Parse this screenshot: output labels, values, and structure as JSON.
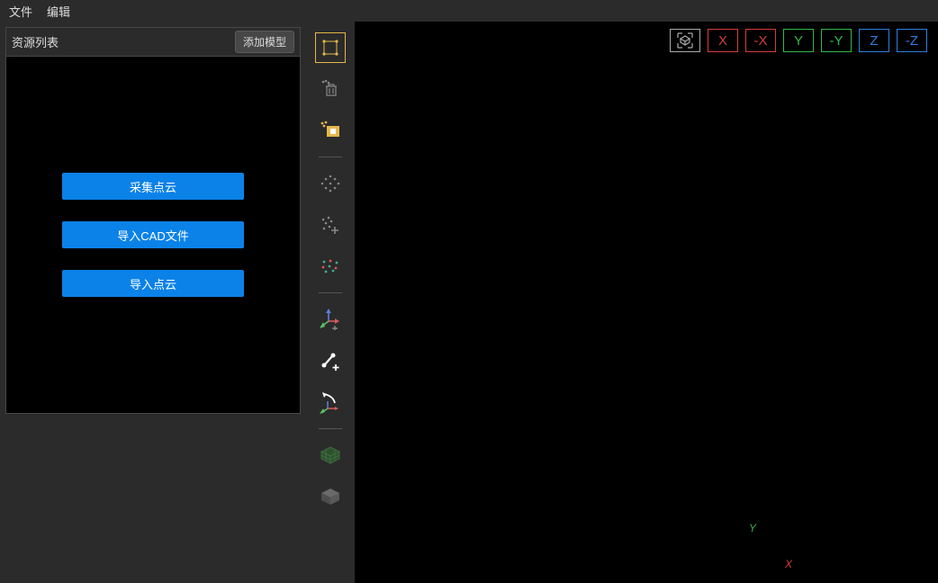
{
  "menu": {
    "file": "文件",
    "edit": "编辑"
  },
  "panel": {
    "title": "资源列表",
    "add_model": "添加模型",
    "btn1": "采集点云",
    "btn2": "导入CAD文件",
    "btn3": "导入点云"
  },
  "tools": {
    "selection": "selection",
    "trash": "trash",
    "photo": "photo",
    "points_all": "points-all",
    "points_add": "points-add",
    "points_color": "points-color",
    "axis_add": "axis-add",
    "edge_add": "edge-add",
    "curve_axis": "curve-axis",
    "mesh1": "mesh-wire",
    "mesh2": "mesh-solid"
  },
  "axes": {
    "x": "X",
    "nx": "-X",
    "y": "Y",
    "ny": "-Y",
    "z": "Z",
    "nz": "-Z"
  },
  "viewport_markers": {
    "x": "X",
    "y": "Y"
  }
}
